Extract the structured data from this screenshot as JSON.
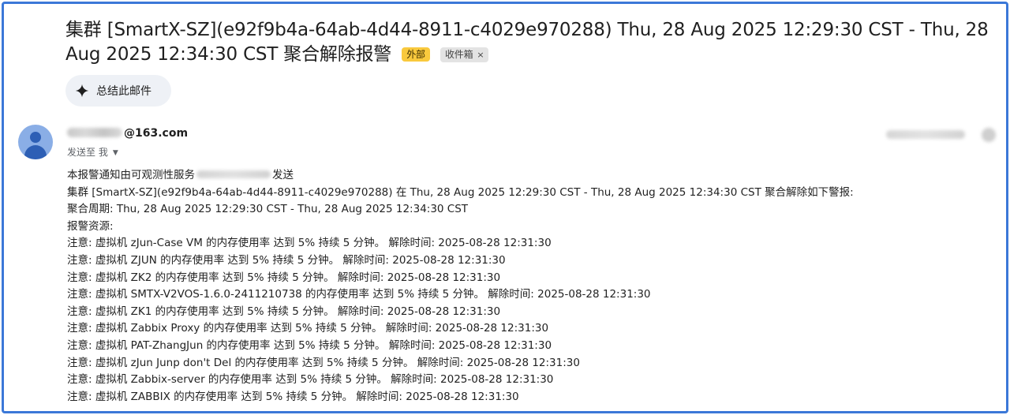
{
  "email": {
    "subject": "集群 [SmartX-SZ](e92f9b4a-64ab-4d44-8911-c4029e970288) Thu, 28 Aug 2025 12:29:30 CST - Thu, 28 Aug 2025 12:34:30 CST 聚合解除报警",
    "labels": {
      "external": "外部",
      "inbox": "收件箱",
      "inbox_remove": "×"
    },
    "summarize_label": "总结此邮件",
    "sender": {
      "domain": "@163.com"
    },
    "recipient": "发送至 我",
    "body": {
      "line1_prefix": "本报警通知由可观测性服务",
      "line1_suffix": "发送",
      "line2": "集群 [SmartX-SZ](e92f9b4a-64ab-4d44-8911-c4029e970288) 在 Thu, 28 Aug 2025 12:29:30 CST - Thu, 28 Aug 2025 12:34:30 CST 聚合解除如下警报:",
      "line3": "聚合周期:  Thu, 28 Aug 2025 12:29:30 CST - Thu, 28 Aug 2025 12:34:30 CST",
      "line4": "报警资源:",
      "alerts": [
        "注意: 虚拟机 zJun-Case VM 的内存使用率 达到 5% 持续 5 分钟。 解除时间: 2025-08-28 12:31:30",
        "注意: 虚拟机 ZJUN 的内存使用率 达到 5% 持续 5 分钟。 解除时间: 2025-08-28 12:31:30",
        "注意: 虚拟机 ZK2 的内存使用率 达到 5% 持续 5 分钟。 解除时间: 2025-08-28 12:31:30",
        "注意: 虚拟机 SMTX-V2VOS-1.6.0-2411210738 的内存使用率 达到 5% 持续 5 分钟。 解除时间: 2025-08-28 12:31:30",
        "注意: 虚拟机 ZK1 的内存使用率 达到 5% 持续 5 分钟。 解除时间: 2025-08-28 12:31:30",
        "注意: 虚拟机 Zabbix Proxy 的内存使用率 达到 5% 持续 5 分钟。 解除时间: 2025-08-28 12:31:30",
        "注意: 虚拟机 PAT-ZhangJun 的内存使用率 达到 5% 持续 5 分钟。 解除时间: 2025-08-28 12:31:30",
        "注意: 虚拟机 zJun Junp don't Del 的内存使用率 达到 5% 持续 5 分钟。 解除时间: 2025-08-28 12:31:30",
        "注意: 虚拟机 Zabbix-server 的内存使用率 达到 5% 持续 5 分钟。 解除时间: 2025-08-28 12:31:30",
        "注意: 虚拟机 ZABBIX 的内存使用率 达到 5% 持续 5 分钟。 解除时间: 2025-08-28 12:31:30"
      ]
    }
  },
  "colors": {
    "frame": "#3b78d8",
    "external_badge": "#f9c93d",
    "avatar": "#8aaee6"
  }
}
